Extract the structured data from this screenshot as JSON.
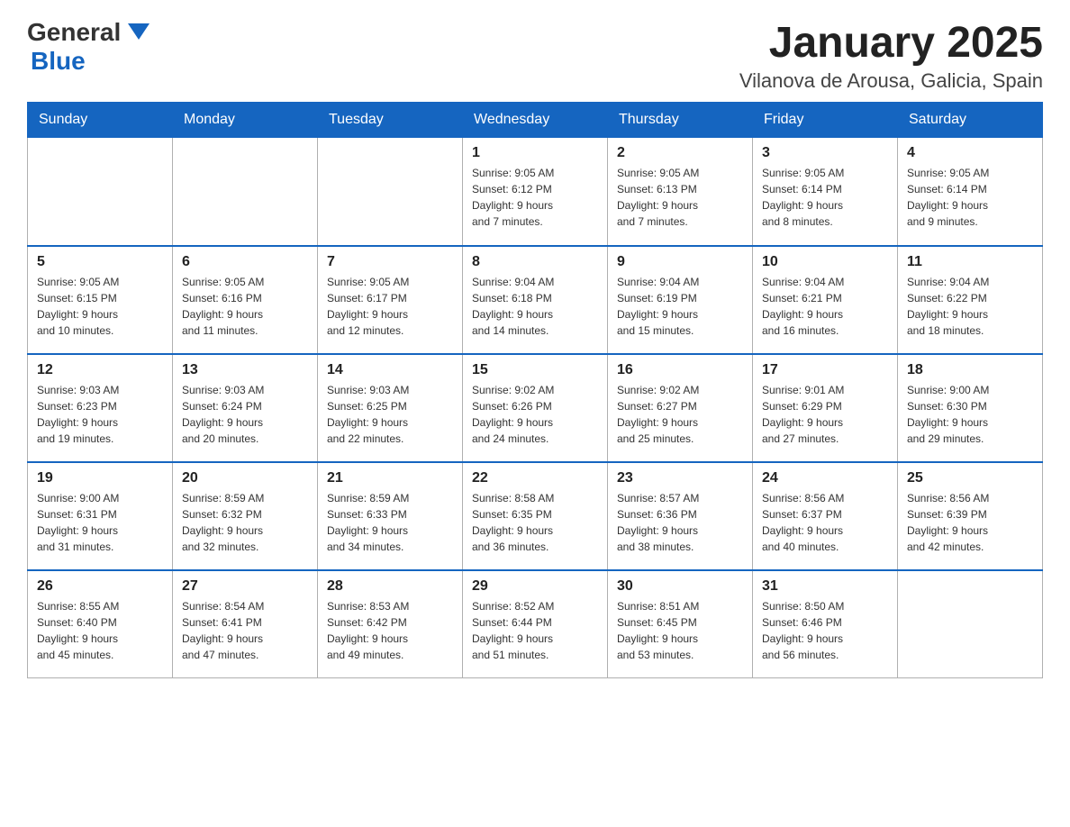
{
  "header": {
    "logo_general": "General",
    "logo_blue": "Blue",
    "month_title": "January 2025",
    "location": "Vilanova de Arousa, Galicia, Spain"
  },
  "weekdays": [
    "Sunday",
    "Monday",
    "Tuesday",
    "Wednesday",
    "Thursday",
    "Friday",
    "Saturday"
  ],
  "weeks": [
    [
      {
        "day": "",
        "info": ""
      },
      {
        "day": "",
        "info": ""
      },
      {
        "day": "",
        "info": ""
      },
      {
        "day": "1",
        "info": "Sunrise: 9:05 AM\nSunset: 6:12 PM\nDaylight: 9 hours\nand 7 minutes."
      },
      {
        "day": "2",
        "info": "Sunrise: 9:05 AM\nSunset: 6:13 PM\nDaylight: 9 hours\nand 7 minutes."
      },
      {
        "day": "3",
        "info": "Sunrise: 9:05 AM\nSunset: 6:14 PM\nDaylight: 9 hours\nand 8 minutes."
      },
      {
        "day": "4",
        "info": "Sunrise: 9:05 AM\nSunset: 6:14 PM\nDaylight: 9 hours\nand 9 minutes."
      }
    ],
    [
      {
        "day": "5",
        "info": "Sunrise: 9:05 AM\nSunset: 6:15 PM\nDaylight: 9 hours\nand 10 minutes."
      },
      {
        "day": "6",
        "info": "Sunrise: 9:05 AM\nSunset: 6:16 PM\nDaylight: 9 hours\nand 11 minutes."
      },
      {
        "day": "7",
        "info": "Sunrise: 9:05 AM\nSunset: 6:17 PM\nDaylight: 9 hours\nand 12 minutes."
      },
      {
        "day": "8",
        "info": "Sunrise: 9:04 AM\nSunset: 6:18 PM\nDaylight: 9 hours\nand 14 minutes."
      },
      {
        "day": "9",
        "info": "Sunrise: 9:04 AM\nSunset: 6:19 PM\nDaylight: 9 hours\nand 15 minutes."
      },
      {
        "day": "10",
        "info": "Sunrise: 9:04 AM\nSunset: 6:21 PM\nDaylight: 9 hours\nand 16 minutes."
      },
      {
        "day": "11",
        "info": "Sunrise: 9:04 AM\nSunset: 6:22 PM\nDaylight: 9 hours\nand 18 minutes."
      }
    ],
    [
      {
        "day": "12",
        "info": "Sunrise: 9:03 AM\nSunset: 6:23 PM\nDaylight: 9 hours\nand 19 minutes."
      },
      {
        "day": "13",
        "info": "Sunrise: 9:03 AM\nSunset: 6:24 PM\nDaylight: 9 hours\nand 20 minutes."
      },
      {
        "day": "14",
        "info": "Sunrise: 9:03 AM\nSunset: 6:25 PM\nDaylight: 9 hours\nand 22 minutes."
      },
      {
        "day": "15",
        "info": "Sunrise: 9:02 AM\nSunset: 6:26 PM\nDaylight: 9 hours\nand 24 minutes."
      },
      {
        "day": "16",
        "info": "Sunrise: 9:02 AM\nSunset: 6:27 PM\nDaylight: 9 hours\nand 25 minutes."
      },
      {
        "day": "17",
        "info": "Sunrise: 9:01 AM\nSunset: 6:29 PM\nDaylight: 9 hours\nand 27 minutes."
      },
      {
        "day": "18",
        "info": "Sunrise: 9:00 AM\nSunset: 6:30 PM\nDaylight: 9 hours\nand 29 minutes."
      }
    ],
    [
      {
        "day": "19",
        "info": "Sunrise: 9:00 AM\nSunset: 6:31 PM\nDaylight: 9 hours\nand 31 minutes."
      },
      {
        "day": "20",
        "info": "Sunrise: 8:59 AM\nSunset: 6:32 PM\nDaylight: 9 hours\nand 32 minutes."
      },
      {
        "day": "21",
        "info": "Sunrise: 8:59 AM\nSunset: 6:33 PM\nDaylight: 9 hours\nand 34 minutes."
      },
      {
        "day": "22",
        "info": "Sunrise: 8:58 AM\nSunset: 6:35 PM\nDaylight: 9 hours\nand 36 minutes."
      },
      {
        "day": "23",
        "info": "Sunrise: 8:57 AM\nSunset: 6:36 PM\nDaylight: 9 hours\nand 38 minutes."
      },
      {
        "day": "24",
        "info": "Sunrise: 8:56 AM\nSunset: 6:37 PM\nDaylight: 9 hours\nand 40 minutes."
      },
      {
        "day": "25",
        "info": "Sunrise: 8:56 AM\nSunset: 6:39 PM\nDaylight: 9 hours\nand 42 minutes."
      }
    ],
    [
      {
        "day": "26",
        "info": "Sunrise: 8:55 AM\nSunset: 6:40 PM\nDaylight: 9 hours\nand 45 minutes."
      },
      {
        "day": "27",
        "info": "Sunrise: 8:54 AM\nSunset: 6:41 PM\nDaylight: 9 hours\nand 47 minutes."
      },
      {
        "day": "28",
        "info": "Sunrise: 8:53 AM\nSunset: 6:42 PM\nDaylight: 9 hours\nand 49 minutes."
      },
      {
        "day": "29",
        "info": "Sunrise: 8:52 AM\nSunset: 6:44 PM\nDaylight: 9 hours\nand 51 minutes."
      },
      {
        "day": "30",
        "info": "Sunrise: 8:51 AM\nSunset: 6:45 PM\nDaylight: 9 hours\nand 53 minutes."
      },
      {
        "day": "31",
        "info": "Sunrise: 8:50 AM\nSunset: 6:46 PM\nDaylight: 9 hours\nand 56 minutes."
      },
      {
        "day": "",
        "info": ""
      }
    ]
  ]
}
